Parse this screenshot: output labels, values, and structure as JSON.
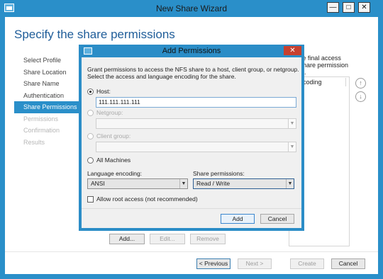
{
  "window": {
    "title": "New Share Wizard",
    "min_glyph": "—",
    "max_glyph": "□",
    "close_glyph": "✕"
  },
  "page": {
    "heading": "Specify the share permissions"
  },
  "nav": {
    "items": [
      {
        "label": "Select Profile",
        "state": "normal"
      },
      {
        "label": "Share Location",
        "state": "normal"
      },
      {
        "label": "Share Name",
        "state": "normal"
      },
      {
        "label": "Authentication",
        "state": "normal"
      },
      {
        "label": "Share Permissions",
        "state": "active"
      },
      {
        "label": "Permissions",
        "state": "disabled"
      },
      {
        "label": "Confirmation",
        "state": "disabled"
      },
      {
        "label": "Results",
        "state": "disabled"
      }
    ]
  },
  "background": {
    "text_line1": "ow. The final access",
    "text_line2": "h the share permission",
    "text_line3": "applied.",
    "column_header": "coding",
    "up_glyph": "↑",
    "down_glyph": "↓",
    "add_label": "Add...",
    "edit_label": "Edit...",
    "remove_label": "Remove"
  },
  "footer": {
    "previous_label": "< Previous",
    "next_label": "Next >",
    "create_label": "Create",
    "cancel_label": "Cancel"
  },
  "dialog": {
    "title": "Add Permissions",
    "close_glyph": "✕",
    "description": "Grant permissions to access the NFS share to a host, client group, or netgroup. Select the access and language encoding for the share.",
    "host_label": "Host:",
    "host_value": "111.111.111.111",
    "netgroup_label": "Netgroup:",
    "client_group_label": "Client group:",
    "all_machines_label": "All Machines",
    "language_encoding_label": "Language encoding:",
    "language_encoding_value": "ANSI",
    "share_permissions_label": "Share permissions:",
    "share_permissions_value": "Read / Write",
    "allow_root_label": "Allow root access (not recommended)",
    "add_label": "Add",
    "cancel_label": "Cancel",
    "dropdown_glyph": "▼"
  }
}
